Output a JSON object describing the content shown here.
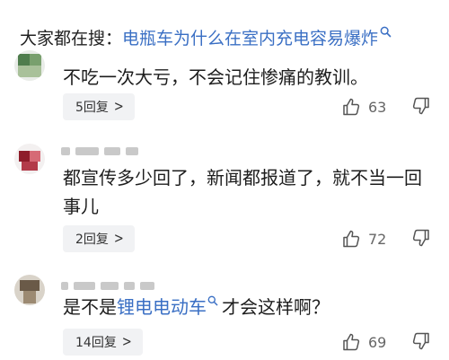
{
  "search": {
    "prefix": "大家都在搜：",
    "query": "电瓶车为什么在室内充电容易爆炸"
  },
  "comments": [
    {
      "text": "不吃一次大亏，不会记住惨痛的教训。",
      "replies_label": "5回复",
      "likes": "63"
    },
    {
      "text": "都宣传多少回了，新闻都报道了，就不当一回事儿",
      "replies_label": "2回复",
      "likes": "72"
    },
    {
      "text_before": "是不是",
      "link_text": "锂电电动车",
      "text_after": "才会这样啊？",
      "replies_label": "14回复",
      "likes": "69"
    }
  ],
  "icons": {
    "search_hint": "search-icon",
    "like": "thumbs-up-icon",
    "dislike": "thumbs-down-icon",
    "reply_chevron": "chevron-right-icon"
  },
  "colors": {
    "link": "#3a6fc4",
    "pill_bg": "#f1f2f4",
    "count": "#666666"
  }
}
